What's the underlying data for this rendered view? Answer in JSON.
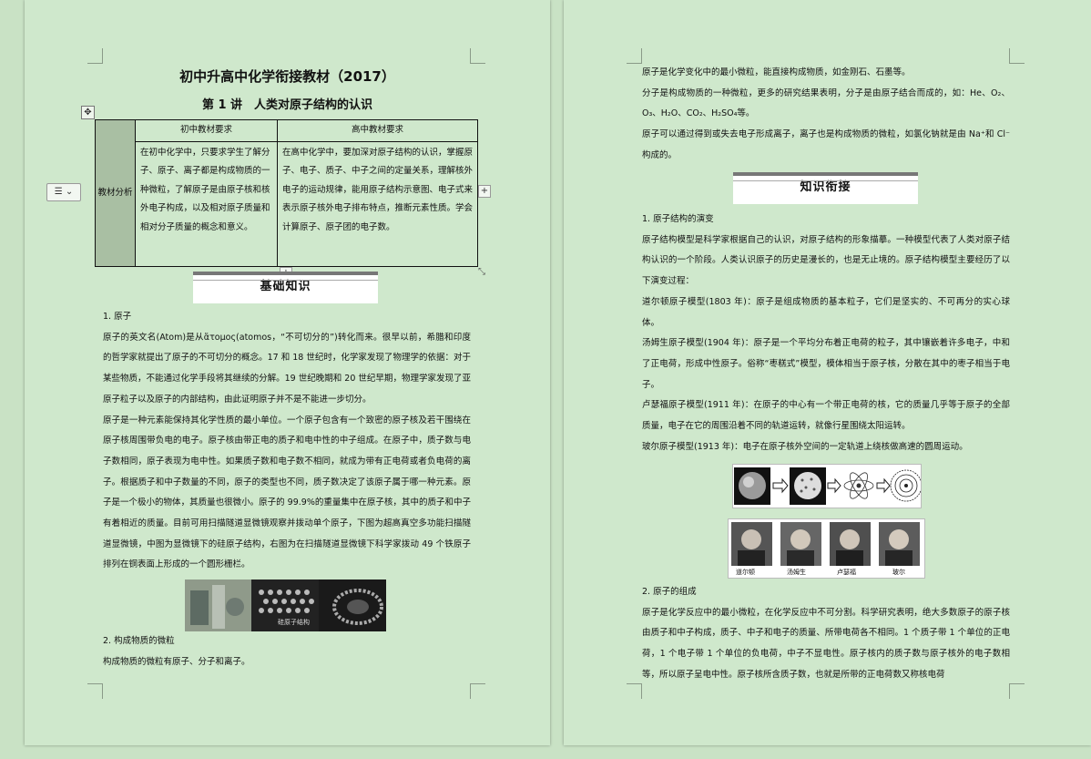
{
  "page1": {
    "title": "初中升高中化学衔接教材（2017）",
    "subtitle": "第 1 讲　人类对原子结构的认识",
    "table": {
      "col_headers": [
        "初中教材要求",
        "高中教材要求"
      ],
      "row_header": "教材分析",
      "junior": "在初中化学中，只要求学生了解分子、原子、离子都是构成物质的一种微粒，了解原子是由原子核和核外电子构成，以及相对原子质量和相对分子质量的概念和意义。",
      "senior": "在高中化学中，要加深对原子结构的认识，掌握原子、电子、质子、中子之间的定量关系，理解核外电子的运动规律，能用原子结构示意图、电子式来表示原子核外电子排布特点，推断元素性质。学会计算原子、原子团的电子数。"
    },
    "section_title": "基础知识",
    "paragraphs": [
      "1.  原子",
      "原子的英文名(Atom)是从ἄτομος(atomos，“不可切分的”)转化而来。很早以前，希腊和印度的哲学家就提出了原子的不可切分的概念。17 和 18 世纪时，化学家发现了物理学的依据：对于某些物质，不能通过化学手段将其继续的分解。19 世纪晚期和 20 世纪早期，物理学家发现了亚原子粒子以及原子的内部结构，由此证明原子并不是不能进一步切分。",
      "原子是一种元素能保持其化学性质的最小单位。一个原子包含有一个致密的原子核及若干围绕在原子核周围带负电的电子。原子核由带正电的质子和电中性的中子组成。在原子中，质子数与电子数相同，原子表现为电中性。如果质子数和电子数不相同，就成为带有正电荷或者负电荷的离子。根据质子和中子数量的不同，原子的类型也不同，质子数决定了该原子属于哪一种元素。原子是一个极小的物体，其质量也很微小。原子的 99.9%的重量集中在原子核，其中的质子和中子有着相近的质量。目前可用扫描隧道显微镜观察并拨动单个原子，下图为超高真空多功能扫描隧道显微镜，中图为显微镜下的硅原子结构，右图为在扫描隧道显微镜下科学家拨动 49 个铁原子排列在铜表面上形成的一个圆形栅栏。"
    ],
    "photo_caption": "硅原子结构",
    "paragraphs_after": [
      "2.  构成物质的微粒",
      "构成物质的微粒有原子、分子和离子。"
    ]
  },
  "page2": {
    "paragraphs_top": [
      "原子是化学变化中的最小微粒，能直接构成物质，如金刚石、石墨等。",
      "分子是构成物质的一种微粒，更多的研究结果表明，分子是由原子结合而成的，如：He、O₂、O₃、H₂O、CO₂、H₂SO₄等。",
      "原子可以通过得到或失去电子形成离子，离子也是构成物质的微粒，如氯化钠就是由 Na⁺和 Cl⁻构成的。"
    ],
    "section_title": "知识衔接",
    "paragraphs_mid": [
      "1.  原子结构的演变",
      "原子结构模型是科学家根据自己的认识，对原子结构的形象描摹。一种模型代表了人类对原子结构认识的一个阶段。人类认识原子的历史是漫长的，也是无止境的。原子结构模型主要经历了以下演变过程：",
      "道尔顿原子模型(1803 年)：原子是组成物质的基本粒子，它们是坚实的、不可再分的实心球体。",
      "汤姆生原子模型(1904 年)：原子是一个平均分布着正电荷的粒子，其中镶嵌着许多电子，中和了正电荷，形成中性原子。俗称“枣糕式”模型，模体相当于原子核，分散在其中的枣子相当于电子。",
      "卢瑟福原子模型(1911 年)：在原子的中心有一个带正电荷的核，它的质量几乎等于原子的全部质量，电子在它的周围沿着不同的轨道运转，就像行星围绕太阳运转。",
      "玻尔原子模型(1913 年)：电子在原子核外空间的一定轨道上绕核做高速的圆周运动。"
    ],
    "scientists": [
      "道尔顿",
      "汤姆生",
      "卢瑟福",
      "玻尔"
    ],
    "paragraphs_bottom": [
      "2.  原子的组成",
      "原子是化学反应中的最小微粒，在化学反应中不可分割。科学研究表明，绝大多数原子的原子核由质子和中子构成，质子、中子和电子的质量、所带电荷各不相同。1 个质子带 1 个单位的正电荷，1 个电子带 1 个单位的负电荷，中子不显电性。原子核内的质子数与原子核外的电子数相等，所以原子呈电中性。原子核所含质子数，也就是所带的正电荷数又称核电荷"
    ]
  }
}
